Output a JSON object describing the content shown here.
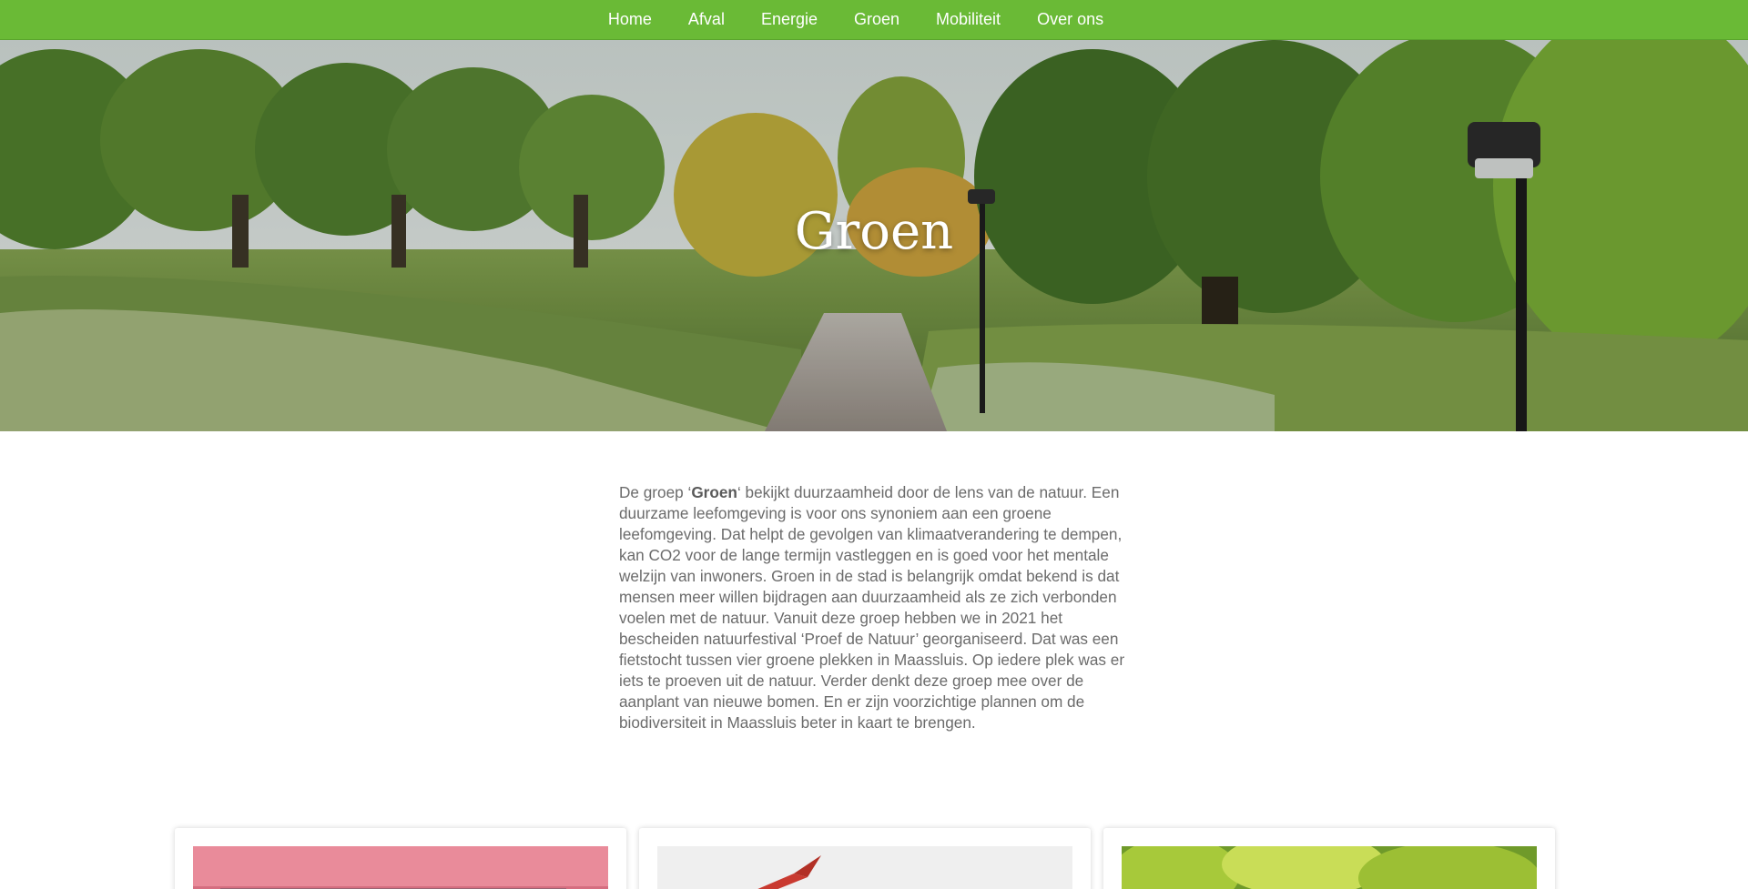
{
  "nav": {
    "items": [
      {
        "label": "Home"
      },
      {
        "label": "Afval"
      },
      {
        "label": "Energie"
      },
      {
        "label": "Groen"
      },
      {
        "label": "Mobiliteit"
      },
      {
        "label": "Over ons"
      }
    ]
  },
  "hero": {
    "title": "Groen"
  },
  "intro": {
    "before": "De groep ‘",
    "bold": "Groen",
    "after": "‘ bekijkt duurzaamheid door de lens van de natuur. Een duurzame leefomgeving is voor ons synoniem aan een groene leefomgeving. Dat helpt de gevolgen van klimaatverandering te dempen, kan CO2 voor de lange termijn vastleggen en is goed voor het mentale welzijn van inwoners. Groen in de stad is belangrijk omdat bekend is dat mensen meer willen bijdragen aan duurzaamheid als ze zich verbonden voelen met de natuur. Vanuit deze groep hebben we in 2021 het bescheiden natuurfestival ‘Proef de Natuur’ georganiseerd. Dat was een fietstocht tussen vier groene plekken in Maassluis. Op iedere plek was er iets te proeven uit de natuur. Verder denkt deze groep mee over de aanplant van nieuwe bomen. En er zijn voorzichtige plannen om de biodiversiteit in Maassluis beter in kaart te brengen."
  },
  "colors": {
    "nav_bg": "#6aba36",
    "body_text": "#6b6b6b"
  }
}
